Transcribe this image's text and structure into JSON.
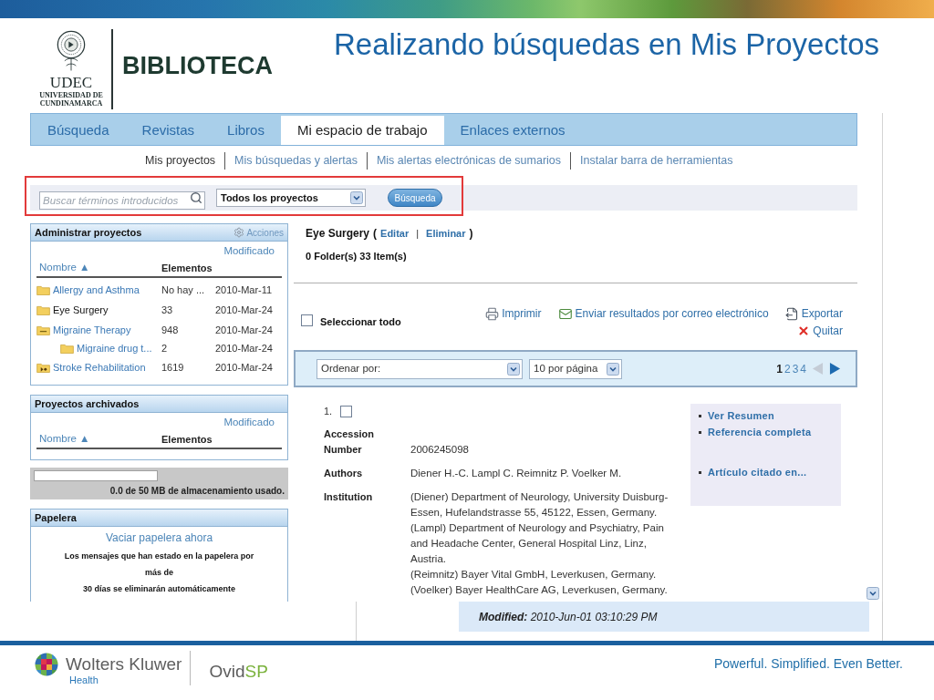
{
  "header": {
    "seal_wordmark": "UDEC",
    "seal_lines": [
      "UNIVERSIDAD DE",
      "CUNDINAMARCA"
    ],
    "library": "BIBLIOTECA",
    "title": "Realizando búsquedas en Mis Proyectos"
  },
  "tabs": [
    {
      "label": "Búsqueda",
      "selected": false
    },
    {
      "label": "Revistas",
      "selected": false
    },
    {
      "label": "Libros",
      "selected": false
    },
    {
      "label": "Mi espacio de trabajo",
      "selected": true
    },
    {
      "label": "Enlaces externos",
      "selected": false
    }
  ],
  "subnav": [
    {
      "label": "Mis proyectos",
      "selected": true
    },
    {
      "label": "Mis búsquedas y alertas",
      "selected": false
    },
    {
      "label": "Mis alertas electrónicas de sumarios",
      "selected": false
    },
    {
      "label": "Instalar barra de herramientas",
      "selected": false
    }
  ],
  "search": {
    "placeholder": "Buscar términos introducidos",
    "scope": "Todos los proyectos",
    "button": "Búsqueda"
  },
  "manage_panel": {
    "title": "Administrar proyectos",
    "action": "Acciones",
    "modified": "Modificado",
    "name_column": "Nombre ▲",
    "items_column": "Elementos",
    "projects": [
      {
        "kind": "folder",
        "name": "Allergy and Asthma",
        "items": "No hay ...",
        "modified": "2010-Mar-11",
        "selected": false
      },
      {
        "kind": "folder",
        "name": "Eye Surgery",
        "items": "33",
        "modified": "2010-Mar-24",
        "selected": true
      },
      {
        "kind": "folder-open",
        "name": "Migraine Therapy",
        "items": "948",
        "modified": "2010-Mar-24",
        "selected": false,
        "children": [
          {
            "kind": "folder",
            "name": "Migraine drug t...",
            "items": "2",
            "modified": "2010-Mar-24",
            "selected": false
          }
        ]
      },
      {
        "kind": "folder-marked",
        "name": "Stroke Rehabilitation",
        "items": "1619",
        "modified": "2010-Mar-24",
        "selected": false
      }
    ]
  },
  "archive_panel": {
    "title": "Proyectos archivados",
    "modified": "Modificado",
    "name_column": "Nombre ▲",
    "items_column": "Elementos"
  },
  "storage": {
    "level": 0,
    "caption": "0.0 de 50 MB de almacenamiento usado."
  },
  "trash": {
    "title": "Papelera",
    "link": "Vaciar papelera ahora",
    "notice": [
      "Los mensajes que han estado en la papelera por",
      "más de",
      "30 días se eliminarán automáticamente"
    ]
  },
  "project": {
    "name": "Eye Surgery",
    "open_paren": "(",
    "edit": "Editar",
    "separator": "|",
    "delete": "Eliminar",
    "close_paren": ")",
    "summary": "0 Folder(s) 33 Item(s)"
  },
  "select_all": {
    "label": "Seleccionar todo",
    "checked": false
  },
  "actions": [
    {
      "kind": "print",
      "label": "Imprimir"
    },
    {
      "kind": "email",
      "label": "Enviar resultados por correo electrónico"
    },
    {
      "kind": "export",
      "label": "Exportar"
    },
    {
      "kind": "remove",
      "label": "Quitar"
    }
  ],
  "sort_bar": {
    "sort": "Ordenar por:",
    "per_page": "10 por página",
    "pages": [
      {
        "label": "1",
        "selected": true
      },
      {
        "label": "2",
        "selected": false
      },
      {
        "label": "3",
        "selected": false
      },
      {
        "label": "4",
        "selected": false
      }
    ],
    "prev": {
      "disabled": true
    },
    "next": {
      "disabled": false
    }
  },
  "results": [
    {
      "number": "1.",
      "checked": false,
      "fields": [
        {
          "label": "Accession Number",
          "values": [
            "2006245098"
          ]
        },
        {
          "label": "Authors",
          "values": [
            "Diener H.-C. Lampl C. Reimnitz P. Voelker M."
          ]
        },
        {
          "label": "Institution",
          "values": [
            "(Diener) Department of Neurology, University Duisburg-Essen, Hufelandstrasse 55, 45122, Essen, Germany.",
            "(Lampl) Department of Neurology and Psychiatry, Pain and Headache Center, General Hospital Linz, Linz, Austria.",
            "(Reimnitz) Bayer Vital GmbH, Leverkusen, Germany.",
            "(Voelker) Bayer HealthCare AG, Leverkusen, Germany."
          ]
        }
      ],
      "link_groups": [
        [
          "Ver Resumen",
          "Referencia completa"
        ],
        [
          "Artículo citado en..."
        ]
      ]
    }
  ],
  "modified_note": "**Modified:** 2010-Jun-01 03:10:29 PM",
  "footer": {
    "brand": "Wolters Kluwer",
    "division": "Health",
    "product": "Ovid",
    "product_suffix": "SP",
    "tagline": "Powerful. Simplified. Even Better."
  }
}
